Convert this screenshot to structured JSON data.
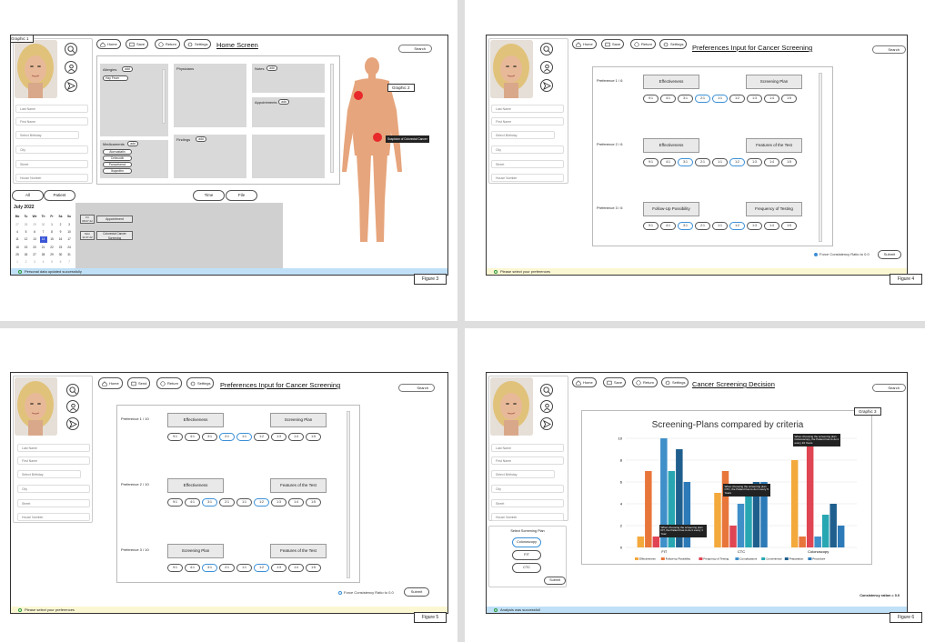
{
  "common": {
    "nav": {
      "home": "Home",
      "save": "Save",
      "save_alt": "Send",
      "return": "Return",
      "settings": "Settings"
    },
    "search": "Search",
    "patient_fields": [
      "Last Name",
      "First Name",
      "Select Birthday",
      "City",
      "Street",
      "House Number"
    ]
  },
  "panel1": {
    "title": "Home Screen",
    "figure": "Figure 3",
    "graphic1": "Graphic 1",
    "graphic2": "Graphic 2",
    "allergies": "Allergies",
    "allergy_item": "Hay Fever",
    "physicians": "Physicians",
    "notes": "Notes",
    "appointments": "Appointments",
    "medicaments": "Medicaments",
    "meds": [
      "Atorvastatin",
      "Celecoxib",
      "Paracetamol",
      "Ibuprofen"
    ],
    "findings": "Findings",
    "add": "add",
    "filters": [
      "All",
      "Patient",
      "Time",
      "File"
    ],
    "month": "July 2022",
    "weekdays": [
      "Mo",
      "Tu",
      "We",
      "Th",
      "Fr",
      "Sa",
      "Su"
    ],
    "days": [
      "27",
      "28",
      "29",
      "30",
      "1",
      "2",
      "3",
      "4",
      "5",
      "6",
      "7",
      "8",
      "9",
      "10",
      "11",
      "12",
      "13",
      "14",
      "15",
      "16",
      "17",
      "18",
      "19",
      "20",
      "21",
      "22",
      "23",
      "24",
      "25",
      "26",
      "27",
      "28",
      "29",
      "30",
      "31",
      "1",
      "2",
      "3",
      "4",
      "5",
      "6",
      "7"
    ],
    "selected_day": "14",
    "events": [
      {
        "date": "Fri 08.07.22",
        "label": "Appointment"
      },
      {
        "date": "Mon 11.07.22",
        "label": "Colorectal Cancer Screening"
      }
    ],
    "suspicion": "Suspicion of Colorectal Cancer",
    "status": "Personal data updated successfully"
  },
  "panel2": {
    "title": "Preferences Input for Cancer Screening",
    "figure": "Figure 4",
    "rates": [
      "9:1",
      "4:1",
      "3:1",
      "2:1",
      "1:1",
      "1:2",
      "1:3",
      "1:4",
      "1:5"
    ],
    "prefs": [
      {
        "label": "Preference 1 / 6",
        "a": "Effectiveness",
        "b": "Screening Plan"
      },
      {
        "label": "Preference 2 / 6",
        "a": "Effectiveness",
        "b": "Features of the Test"
      },
      {
        "label": "Preference 3 / 6",
        "a": "Follow-Up Possibility",
        "b": "Frequency of Testing"
      }
    ],
    "force": "Force Consistency Ratio to 0.0",
    "submit": "Submit",
    "status": "Please select your preferences"
  },
  "panel3": {
    "title": "Preferences Input for Cancer Screening",
    "figure": "Figure 5",
    "prefs": [
      {
        "label": "Preference 1 / 10",
        "a": "Effectiveness",
        "b": "Screening Plan"
      },
      {
        "label": "Preference 2 / 10",
        "a": "Effectiveness",
        "b": "Features of the Test"
      },
      {
        "label": "Preference 3 / 10",
        "a": "Screening Plan",
        "b": "Features of the Test"
      }
    ],
    "force": "Force Consistency Ratio to 0.0",
    "submit": "Submit",
    "status": "Please select your preferences"
  },
  "panel4": {
    "title": "Cancer Screening Decision",
    "figure": "Figure 6",
    "graphic3": "Graphic 3",
    "select_plan": "Select Screening Plan",
    "plans": [
      "Colonoscopy",
      "FIT",
      "CTC"
    ],
    "submit": "Submit",
    "consistency": "Consistency ration = 0.0",
    "status": "Analysis was successfull",
    "tips": [
      "When choosing the screening plan FIT, the Patient has to do it every 1 Year",
      "When choosing the screening plan CTC, the Patient has to do it every 5 Years",
      "When choosing the screening plan Colonoscopy, the Patient has to do it every 10 Years"
    ]
  },
  "chart_data": {
    "type": "bar",
    "title": "Screening-Plans compared by criteria",
    "categories": [
      "FIT",
      "CTC",
      "Colonoscopy"
    ],
    "ylim": [
      0,
      10
    ],
    "yticks": [
      0,
      2,
      4,
      6,
      8,
      10
    ],
    "series": [
      {
        "name": "Effectiveness",
        "color": "#f3a93c",
        "values": [
          1,
          5,
          8
        ]
      },
      {
        "name": "Follow-up Possibility",
        "color": "#e8763a",
        "values": [
          7,
          7,
          1
        ]
      },
      {
        "name": "Frequency of Testing",
        "color": "#e04553",
        "values": [
          1,
          2,
          10
        ]
      },
      {
        "name": "Complications",
        "color": "#3f8fc9",
        "values": [
          10,
          4,
          1
        ]
      },
      {
        "name": "Convenience",
        "color": "#28a7b3",
        "values": [
          7,
          5,
          3
        ]
      },
      {
        "name": "Preparation",
        "color": "#1f5f8e",
        "values": [
          9,
          6,
          4
        ]
      },
      {
        "name": "Procedure",
        "color": "#2d7ab8",
        "values": [
          6,
          6,
          2
        ]
      }
    ]
  }
}
